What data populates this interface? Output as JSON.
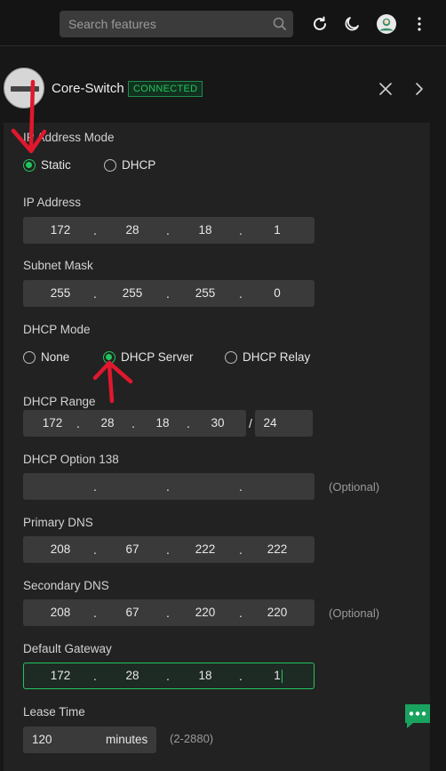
{
  "search": {
    "placeholder": "Search features"
  },
  "device": {
    "name": "Core-Switch",
    "status": "CONNECTED"
  },
  "ip_mode": {
    "label": "IP Address Mode",
    "options": [
      "Static",
      "DHCP"
    ],
    "selected": "Static"
  },
  "ip_address": {
    "label": "IP Address",
    "octets": [
      "172",
      "28",
      "18",
      "1"
    ]
  },
  "subnet_mask": {
    "label": "Subnet Mask",
    "octets": [
      "255",
      "255",
      "255",
      "0"
    ]
  },
  "dhcp_mode": {
    "label": "DHCP Mode",
    "options": [
      "None",
      "DHCP Server",
      "DHCP Relay"
    ],
    "selected": "DHCP Server"
  },
  "dhcp_range": {
    "label": "DHCP Range",
    "octets": [
      "172",
      "28",
      "18",
      "30"
    ],
    "separator": "/",
    "prefix": "24"
  },
  "dhcp_option_138": {
    "label": "DHCP Option 138",
    "octets": [
      "",
      "",
      "",
      ""
    ],
    "hint": "(Optional)"
  },
  "primary_dns": {
    "label": "Primary DNS",
    "octets": [
      "208",
      "67",
      "222",
      "222"
    ]
  },
  "secondary_dns": {
    "label": "Secondary DNS",
    "octets": [
      "208",
      "67",
      "220",
      "220"
    ],
    "hint": "(Optional)"
  },
  "default_gateway": {
    "label": "Default Gateway",
    "octets": [
      "172",
      "28",
      "18",
      "1"
    ]
  },
  "lease_time": {
    "label": "Lease Time",
    "value": "120",
    "unit": "minutes",
    "hint": "(2-2880)"
  },
  "colors": {
    "accent": "#22c55e",
    "annotation_arrow": "#e0182d",
    "panel": "#222222",
    "field": "#3a3a3a"
  },
  "icons": [
    "search-icon",
    "refresh-icon",
    "moon-icon",
    "user-avatar",
    "more-vertical-icon",
    "close-icon",
    "chevron-right-icon",
    "chat-icon"
  ]
}
